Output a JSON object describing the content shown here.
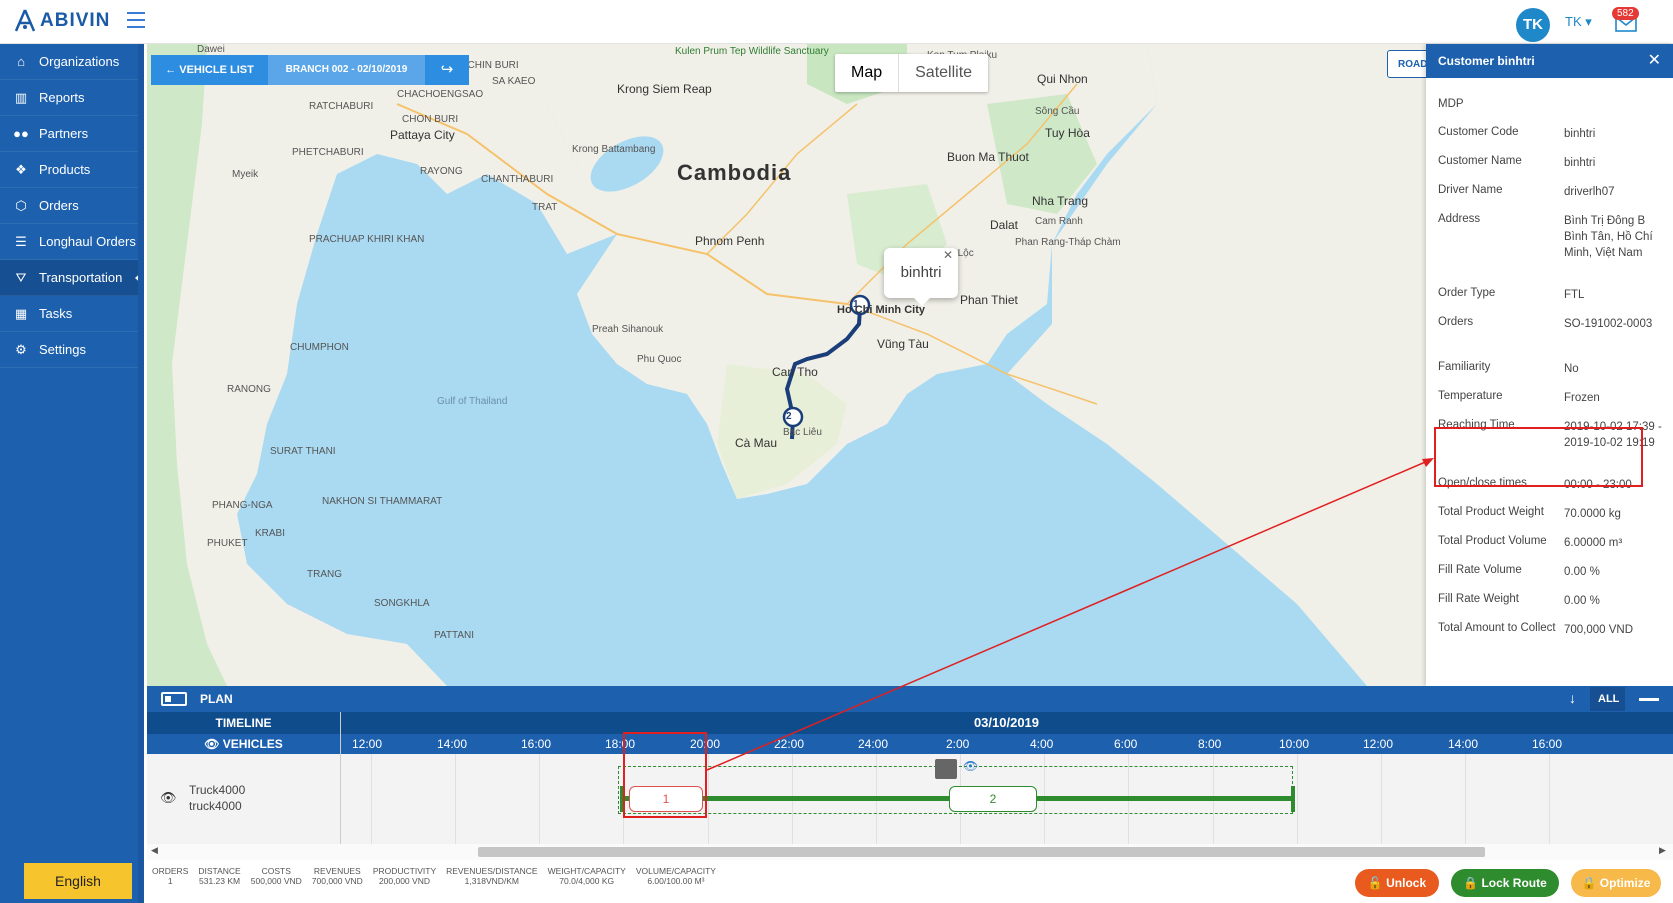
{
  "app": {
    "logo": "ABIVIN"
  },
  "user": {
    "initials": "TK",
    "name": "TK ▾",
    "mail_count": "582"
  },
  "sidebar": {
    "items": [
      {
        "label": "Organizations",
        "icon": "home-icon"
      },
      {
        "label": "Reports",
        "icon": "bar-chart-icon"
      },
      {
        "label": "Partners",
        "icon": "users-icon"
      },
      {
        "label": "Products",
        "icon": "dropbox-icon"
      },
      {
        "label": "Orders",
        "icon": "cubes-icon"
      },
      {
        "label": "Longhaul Orders",
        "icon": "list-icon"
      },
      {
        "label": "Transportation",
        "icon": "road-icon",
        "active": true
      },
      {
        "label": "Tasks",
        "icon": "calendar-icon"
      },
      {
        "label": "Settings",
        "icon": "gear-icon"
      }
    ],
    "language": "English"
  },
  "map": {
    "vehicle_list_btn": "← VEHICLE LIST",
    "branch_btn": "BRANCH 002 - 02/10/2019",
    "map_type": {
      "map": "Map",
      "satellite": "Satellite"
    },
    "road_btn": "ROAD",
    "popup": "binhtri",
    "labels": {
      "cambodia": "Cambodia",
      "phnom_penh": "Phnom Penh",
      "bangkok": "CHACHOENGSAO",
      "pattaya": "Pattaya City",
      "gulf": "Gulf of Thailand",
      "can_tho": "Can Tho",
      "ca_mau": "Cà Mau",
      "vung_tau": "Vũng Tàu",
      "phan_thiet": "Phan Thiet",
      "nha_trang": "Nha Trang",
      "dalat": "Dalat",
      "buon_ma_thuot": "Buon Ma Thuot",
      "qui_nhon": "Qui Nhon",
      "tuy_hoa": "Tuy Hòa",
      "krong": "Krong Siem Reap",
      "battambang": "Krong Battambang",
      "ranong": "RANONG",
      "chumphon": "CHUMPHON",
      "surat": "SURAT THANI",
      "phuket": "PHUKET",
      "krabi": "KRABI",
      "phang_nga": "PHANG-NGA",
      "nakhon": "NAKHON SI THAMMARAT",
      "songkhla": "SONGKHLA",
      "trang": "TRANG",
      "pattani": "PATTANI",
      "ratchaburi": "RATCHABURI",
      "phetchaburi": "PHETCHABURI",
      "prachuap": "PRACHUAP KHIRI KHAN",
      "rayong": "RAYONG",
      "chanthaburi": "CHANTHABURI",
      "trat": "TRAT",
      "kon_tum": "Kon Tum Pleiku",
      "dawei": "Dawei",
      "myeik": "Myeik",
      "preah": "Preah Sihanouk",
      "phu_quoc": "Phu Quoc",
      "bac_lieu": "Bạc Liêu",
      "ho_chi_minh": "Ho Chi Minh City",
      "song_cau": "Sông Cầu",
      "cam_ranh": "Cam Ranh",
      "phan_rang": "Phan Rang-Tháp Chàm",
      "bao_loc": "Bảo Lộc",
      "kulen": "Kulen Prum Tep Wildlife Sanctuary",
      "prachin": "PRACHIN BURI",
      "sa_kaeo": "SA KAEO",
      "chon_buri": "CHON BURI"
    },
    "markers": [
      "1",
      "2"
    ]
  },
  "customer_panel": {
    "title": "Customer binhtri",
    "section": "MDP",
    "rows": [
      {
        "key": "Customer Code",
        "val": "binhtri"
      },
      {
        "key": "Customer Name",
        "val": "binhtri"
      },
      {
        "key": "Driver Name",
        "val": "driverlh07"
      },
      {
        "key": "Address",
        "val": "Bình Trị Đông B Bình Tân, Hồ Chí Minh, Việt Nam"
      },
      {
        "key": "Order Type",
        "val": "FTL"
      },
      {
        "key": "Orders",
        "val": "SO-191002-0003"
      },
      {
        "key": "Familiarity",
        "val": "No"
      },
      {
        "key": "Temperature",
        "val": "Frozen"
      },
      {
        "key": "Reaching Time",
        "val": "2019-10-02 17:39 - 2019-10-02 19:19"
      },
      {
        "key": "Open/close times",
        "val": "00:00 - 23:00"
      },
      {
        "key": "Total Product Weight",
        "val": "70.0000 kg"
      },
      {
        "key": "Total Product Volume",
        "val": "6.00000 m³"
      },
      {
        "key": "Fill Rate Volume",
        "val": "0.00 %"
      },
      {
        "key": "Fill Rate Weight",
        "val": "0.00 %"
      },
      {
        "key": "Total Amount to Collect",
        "val": "700,000 VND"
      }
    ]
  },
  "plan": {
    "title": "PLAN",
    "all_label": "ALL",
    "timeline_label": "TIMELINE",
    "vehicles_label": "VEHICLES",
    "date": "03/10/2019",
    "hours": [
      "12:00",
      "14:00",
      "16:00",
      "18:00",
      "20:00",
      "22:00",
      "24:00",
      "2:00",
      "4:00",
      "6:00",
      "8:00",
      "10:00",
      "12:00",
      "14:00",
      "16:00"
    ],
    "vehicle": {
      "name": "Truck4000",
      "plate": "truck4000"
    },
    "stops": [
      "1",
      "2"
    ]
  },
  "stats": [
    {
      "label": "ORDERS",
      "value": "1"
    },
    {
      "label": "DISTANCE",
      "value": "531.23 KM"
    },
    {
      "label": "COSTS",
      "value": "500,000 VND"
    },
    {
      "label": "REVENUES",
      "value": "700,000 VND"
    },
    {
      "label": "PRODUCTIVITY",
      "value": "200,000 VND"
    },
    {
      "label": "REVENUES/DISTANCE",
      "value": "1,318VND/KM"
    },
    {
      "label": "WEIGHT/CAPACITY",
      "value": "70.0/4,000 KG"
    },
    {
      "label": "VOLUME/CAPACITY",
      "value": "6.00/100.00 M³"
    }
  ],
  "actions": {
    "unlock": "🔓 Unlock",
    "lock": "🔒 Lock Route",
    "optimize": "🔒 Optimize"
  },
  "colors": {
    "primary": "#1d60ae",
    "route_green": "#2e8b2e",
    "alert_red": "#e02020",
    "unlock": "#e85a1e",
    "optimize": "#f6b94a"
  }
}
